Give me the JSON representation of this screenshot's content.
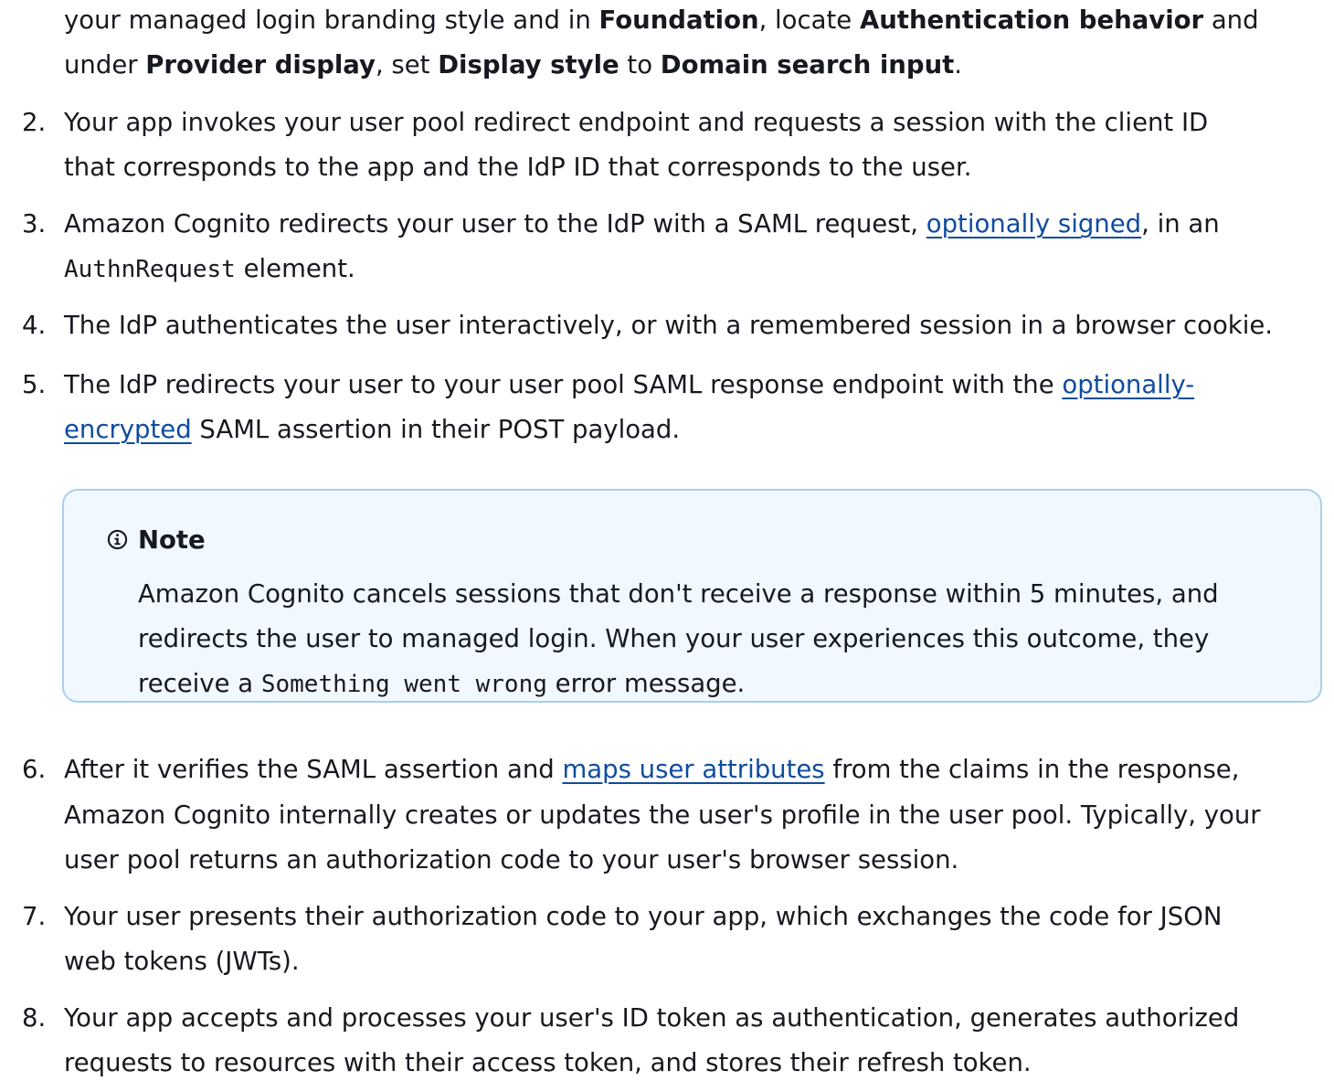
{
  "document": {
    "step1_cont": {
      "line1_prefix": "your managed login branding style and in ",
      "foundation": "Foundation",
      "locate": ", locate ",
      "auth_behavior": "Authentication behavior",
      "and": " and",
      "under": "under ",
      "provider_display": "Provider display",
      "set": ", set ",
      "display_style": "Display style",
      "to": " to ",
      "domain_search_input": "Domain search input",
      "period": "."
    },
    "step2": {
      "number": "2.",
      "line1": "Your app invokes your user pool redirect endpoint and requests a session with the client ID",
      "line2": "that corresponds to the app and the IdP ID that corresponds to the user."
    },
    "step3": {
      "number": "3.",
      "line1_prefix": "Amazon Cognito redirects your user to the IdP with a SAML request, ",
      "link": "optionally signed",
      "line1_suffix": ", in an",
      "code": "AuthnRequest",
      "line2_suffix": " element."
    },
    "step4": {
      "number": "4.",
      "line1": "The IdP authenticates the user interactively, or with a remembered session in a browser cookie."
    },
    "step5": {
      "number": "5.",
      "line1_prefix": "The IdP redirects your user to your user pool SAML response endpoint with the ",
      "link_part1": "optionally-",
      "link_part2": "encrypted",
      "line2_suffix": " SAML assertion in their POST payload."
    },
    "note": {
      "title": "Note",
      "line1": "Amazon Cognito cancels sessions that don't receive a response within 5 minutes, and",
      "line2": "redirects the user to managed login. When your user experiences this outcome, they",
      "line3_prefix": "receive a ",
      "code": "Something went wrong",
      "line3_suffix": " error message."
    },
    "step6": {
      "number": "6.",
      "line1_prefix": "After it verifies the SAML assertion and ",
      "link": "maps user attributes",
      "line1_suffix": " from the claims in the response,",
      "line2": "Amazon Cognito internally creates or updates the user's profile in the user pool. Typically, your",
      "line3": "user pool returns an authorization code to your user's browser session."
    },
    "step7": {
      "number": "7.",
      "line1": "Your user presents their authorization code to your app, which exchanges the code for JSON",
      "line2": "web tokens (JWTs)."
    },
    "step8": {
      "number": "8.",
      "line1": "Your app accepts and processes your user's ID token as authentication, generates authorized",
      "line2": "requests to resources with their access token, and stores their refresh token."
    }
  },
  "colors": {
    "text": "#16191f",
    "link": "#0f4c9f",
    "note_background": "#f1f8fe",
    "note_border": "#a8cfef"
  },
  "icons": {
    "note": "info-circle-icon"
  }
}
